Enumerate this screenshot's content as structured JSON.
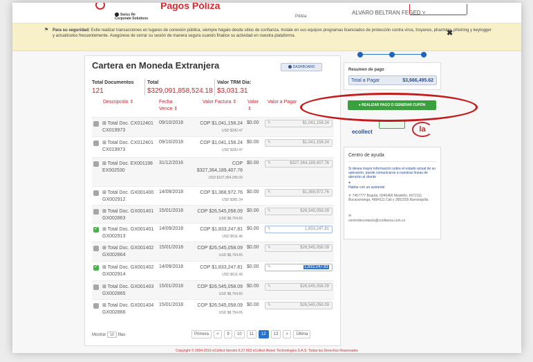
{
  "header": {
    "brand": "Pagos Póliza",
    "swiss": "Swiss Re",
    "swiss_sub": "Corporate Solutions",
    "poliza": "Póliza",
    "user": "ALVARO BELTRAN FEGED ˅"
  },
  "notice": {
    "bold": "Para su seguridad:",
    "text": "Evite realizar transacciones en lugares de conexión pública, siempre hágalo desde sitios de confianza. Instale en sus equipos programas licenciados de protección contra virus, troyanos, pharming, phishing y keylogger y actualícelos frecuentemente. Asegúrese de cerrar su sesión de manera segura cuando finalice su actividad en nuestra plataforma.",
    "close": "✖"
  },
  "main": {
    "title": "Cartera en Moneda Extranjera",
    "dashboard": "DASHBOARD",
    "summary": {
      "total_docs_label": "Total Documentos",
      "total_docs": "121",
      "total_label": "Total",
      "total": "$329,091,858,524.18",
      "trm_label": "Valor TRM Dia:",
      "trm": "$3,031.31"
    },
    "columns": {
      "descripcion": "Descripción ⇕",
      "fecha": "Fecha Vence ⇕",
      "valor_factura": "Valor Factura ⇕",
      "valor": "Valor ⇕",
      "valor_pagar": "Valor a Pagar"
    },
    "rows": [
      {
        "doc": "⊞ Total Doc. CX012401 CX019973",
        "fecha": "09/10/2018",
        "valor_factura": "COP $1,041,158.24",
        "usd": "USD $292.47",
        "valor": "$0.00",
        "pagar": "$1,041,158.24",
        "checked": false
      },
      {
        "doc": "⊞ Total Doc. CX012401 CX019973",
        "fecha": "09/10/2018",
        "valor_factura": "COP $1,041,158.24",
        "usd": "USD $292.47",
        "valor": "$0.00",
        "pagar": "$1,041,158.24",
        "checked": false
      },
      {
        "doc": "⊞ Total Doc. EX001198 EX002530",
        "fecha": "31/12/2016",
        "valor_factura": "COP $327,364,189,407.76",
        "usd": "USD $107,994,296.00",
        "valor": "$0.00",
        "pagar": "$327,364,189,407.76",
        "checked": false
      },
      {
        "doc": "⊞ Total Doc. GX001400 GX002912",
        "fecha": "14/09/2018",
        "valor_factura": "COP $1,368,972.76",
        "usd": "USD $381.34",
        "valor": "$0.00",
        "pagar": "$1,368,972.76",
        "checked": false
      },
      {
        "doc": "⊞ Total Doc. GX001401 GX002863",
        "fecha": "15/01/2018",
        "valor_factura": "COP $26,545,058.09",
        "usd": "USD $8,754.65",
        "valor": "$0.00",
        "pagar": "$26,545,058.09",
        "checked": false
      },
      {
        "doc": "⊞ Total Doc. GX001401 GX002913",
        "fecha": "14/09/2018",
        "valor_factura": "COP $1,833,247.81",
        "usd": "USD $511.46",
        "valor": "$0.00",
        "pagar": "1,833,247.81",
        "checked": true
      },
      {
        "doc": "⊞ Total Doc. GX001402 GX002864",
        "fecha": "15/01/2018",
        "valor_factura": "COP $26,545,058.09",
        "usd": "USD $8,754.65",
        "valor": "$0.00",
        "pagar": "$26,545,058.09",
        "checked": false
      },
      {
        "doc": "⊞ Total Doc. GX001402 GX002914",
        "fecha": "14/09/2018",
        "valor_factura": "COP $1,833,247.81",
        "usd": "USD $511.46",
        "valor": "$0.00",
        "pagar": "1,833,247.81",
        "checked": true
      },
      {
        "doc": "⊞ Total Doc. GX001403 GX002865",
        "fecha": "15/01/2018",
        "valor_factura": "COP $26,545,058.09",
        "usd": "USD $8,754.65",
        "valor": "$0.00",
        "pagar": "$26,545,058.09",
        "checked": false
      },
      {
        "doc": "⊞ Total Doc. GX001404 GX002866",
        "fecha": "15/01/2018",
        "valor_factura": "COP $26,545,058.09",
        "usd": "USD $8,754.65",
        "valor": "$0.00",
        "pagar": "$26,545,058.09",
        "checked": false
      }
    ],
    "footer": {
      "mostrar": "Mostrar",
      "per_page": "10",
      "filas": "filas",
      "pages": [
        "Primera",
        "<",
        "9",
        "10",
        "11",
        "12",
        "13",
        ">",
        "Última"
      ],
      "current_page": "12"
    }
  },
  "side": {
    "resumen_title": "Resumen de pago",
    "total_label": "Total a Pagar",
    "total_value": "$3,666,495.62",
    "pay_button": "REALIZAR PAGO O GENERAR CUPÓN",
    "ecollect": "ecollect",
    "la": "la",
    "help_title": "Centro de ayuda",
    "help_text": "Si desea mayor información sobre el estado actual de su operación, puede comunicarse a nuestras líneas de atención al cliente",
    "chat": "Hablar con un asistente",
    "phones": "7457777 Bogotá, 6040465 Medellín, 6972111 Bucaramanga, 4894111 Cali y 3851555 Barranquilla",
    "email": "centrodecontacto@confianza.com.co"
  },
  "copyright": "Copyright © 2004-2016  eCollect  Versión 6.37.003  eCollect Avisor Technologies S.A.S. Todos los Derechos Reservados",
  "colors": {
    "accent": "#d9262e",
    "primary": "#2a73c9",
    "success": "#3aa03e"
  }
}
